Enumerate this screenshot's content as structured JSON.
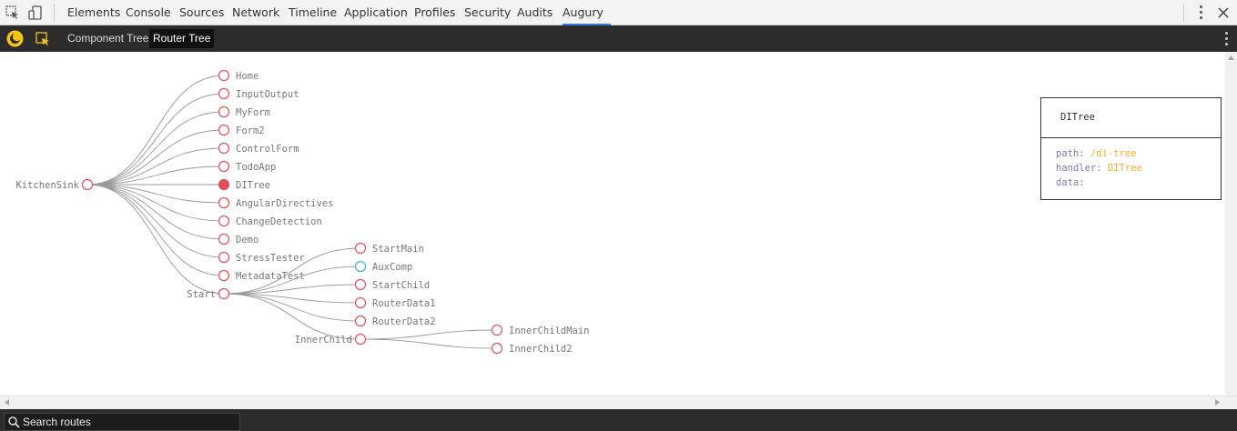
{
  "devtools": {
    "tabs": [
      "Elements",
      "Console",
      "Sources",
      "Network",
      "Timeline",
      "Application",
      "Profiles",
      "Security",
      "Audits",
      "Augury"
    ],
    "active_tab": "Augury"
  },
  "augury": {
    "tabs": [
      "Component Tree",
      "Router Tree"
    ],
    "active_tab": "Router Tree"
  },
  "tree": {
    "root": "KitchenSink",
    "children": [
      "Home",
      "InputOutput",
      "MyForm",
      "Form2",
      "ControlForm",
      "TodoApp",
      "DITree",
      "AngularDirectives",
      "ChangeDetection",
      "Demo",
      "StressTester",
      "MetadataTest",
      "Start"
    ],
    "start_children": [
      "StartMain",
      "AuxComp",
      "StartChild",
      "RouterData1",
      "RouterData2",
      "InnerChild"
    ],
    "inner_children": [
      "InnerChildMain",
      "InnerChild2"
    ],
    "selected": "DITree",
    "aux": "AuxComp"
  },
  "details": {
    "title": "DITree",
    "path_label": "path:",
    "path_value": "/di-tree",
    "handler_label": "handler:",
    "handler_value": "DITree",
    "data_label": "data:"
  },
  "search": {
    "placeholder": "Search routes"
  },
  "colors": {
    "node": "#e0505a",
    "aux": "#3cb4c8",
    "edge": "#999999"
  }
}
